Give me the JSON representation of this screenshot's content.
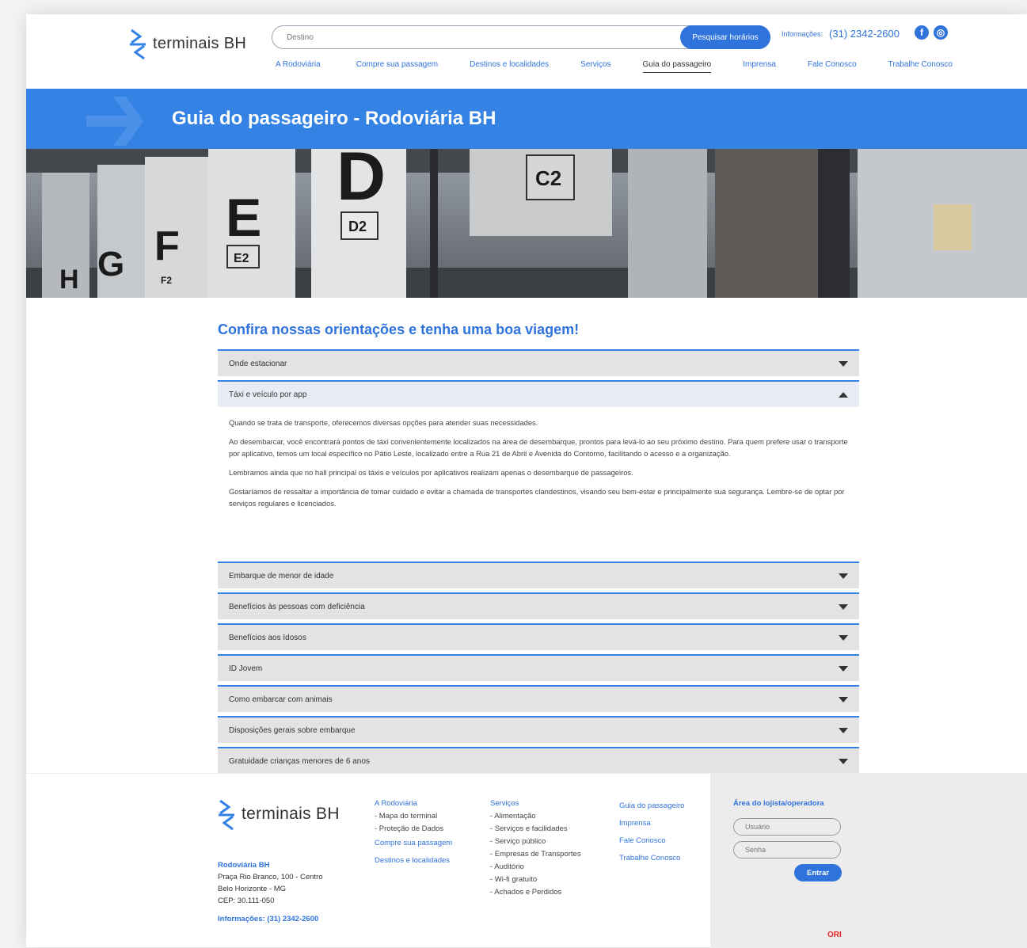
{
  "header": {
    "logo_text": "terminais BH",
    "search_placeholder": "Destino",
    "search_button": "Pesquisar horários",
    "info_label": "Informações:",
    "info_phone": "(31) 2342-2600",
    "social": [
      {
        "icon": "facebook-icon",
        "glyph": "f"
      },
      {
        "icon": "instagram-icon",
        "glyph": "◎"
      }
    ]
  },
  "nav": [
    {
      "label": "A Rodoviária",
      "active": false
    },
    {
      "label": "Compre sua passagem",
      "active": false
    },
    {
      "label": "Destinos e localidades",
      "active": false
    },
    {
      "label": "Serviços",
      "active": false
    },
    {
      "label": "Guia do passageiro",
      "active": true
    },
    {
      "label": "Imprensa",
      "active": false
    },
    {
      "label": "Fale Conosco",
      "active": false
    },
    {
      "label": "Trabalhe Conosco",
      "active": false
    }
  ],
  "banner": {
    "title": "Guia do passageiro - Rodoviária BH"
  },
  "hero": {
    "signs": [
      "H",
      "G",
      "F",
      "F2",
      "E",
      "E2",
      "D",
      "D2",
      "C2"
    ]
  },
  "content": {
    "headline": "Confira nossas orientações e tenha uma boa viagem!",
    "accordion": [
      {
        "title": "Onde estacionar",
        "open": false
      },
      {
        "title": "Táxi e veículo por app",
        "open": true,
        "paragraphs": [
          "Quando se trata de transporte, oferecemos diversas opções para atender suas necessidades.",
          "Ao desembarcar, você encontrará pontos de táxi convenientemente localizados na área de desembarque, prontos para levá-lo ao seu próximo destino. Para quem prefere usar o transporte por aplicativo, temos um local específico no Pátio Leste, localizado entre a Rua 21 de Abril e Avenida do Contorno, facilitando o acesso e a organização.",
          "Lembramos ainda que no hall principal os táxis e veículos por aplicativos realizam apenas o desembarque de passageiros.",
          "Gostaríamos de ressaltar a importância de tomar cuidado e evitar a chamada de transportes clandestinos, visando seu bem-estar e principalmente sua segurança. Lembre-se de optar por serviços regulares e licenciados."
        ]
      },
      {
        "title": "Embarque de menor de idade",
        "open": false
      },
      {
        "title": "Benefícios às pessoas com deficiência",
        "open": false
      },
      {
        "title": "Benefícios aos Idosos",
        "open": false
      },
      {
        "title": "ID Jovem",
        "open": false
      },
      {
        "title": "Como embarcar com animais",
        "open": false
      },
      {
        "title": "Disposições gerais sobre embarque",
        "open": false
      },
      {
        "title": "Gratuidade crianças menores de 6 anos",
        "open": false
      }
    ]
  },
  "footer": {
    "logo_text": "terminais BH",
    "address_title": "Rodoviária BH",
    "address_lines": [
      "Praça Rio Branco, 100 - Centro",
      "Belo Horizonte - MG",
      "CEP: 30.111-050"
    ],
    "phone": "Informações: (31) 2342-2600",
    "col1": [
      {
        "text": "A Rodoviária",
        "type": "link"
      },
      {
        "text": "- Mapa do terminal",
        "type": "sub"
      },
      {
        "text": "- Proteção de Dados",
        "type": "sub"
      },
      {
        "text": "Compre sua passagem",
        "type": "link"
      },
      {
        "text": "Destinos e localidades",
        "type": "link"
      }
    ],
    "col2": [
      {
        "text": "Serviços",
        "type": "link"
      },
      {
        "text": "- Alimentação",
        "type": "sub"
      },
      {
        "text": "- Serviços e facilidades",
        "type": "sub"
      },
      {
        "text": "- Serviço público",
        "type": "sub"
      },
      {
        "text": "- Empresas de Transportes",
        "type": "sub"
      },
      {
        "text": "- Auditório",
        "type": "sub"
      },
      {
        "text": "- Wi-fi gratuito",
        "type": "sub"
      },
      {
        "text": "- Achados e Perdidos",
        "type": "sub"
      }
    ],
    "col3": [
      {
        "text": "Guia do passageiro",
        "type": "link"
      },
      {
        "text": "Imprensa",
        "type": "link"
      },
      {
        "text": "Fale Conosco",
        "type": "link"
      },
      {
        "text": "Trabalhe Conosco",
        "type": "link"
      }
    ],
    "login": {
      "title": "Área do lojista/operadora",
      "user_placeholder": "Usuário",
      "password_placeholder": "Senha",
      "button": "Entrar",
      "badge": "ORI"
    }
  },
  "colors": {
    "accent": "#2f73dc",
    "banner": "#3382e4"
  }
}
